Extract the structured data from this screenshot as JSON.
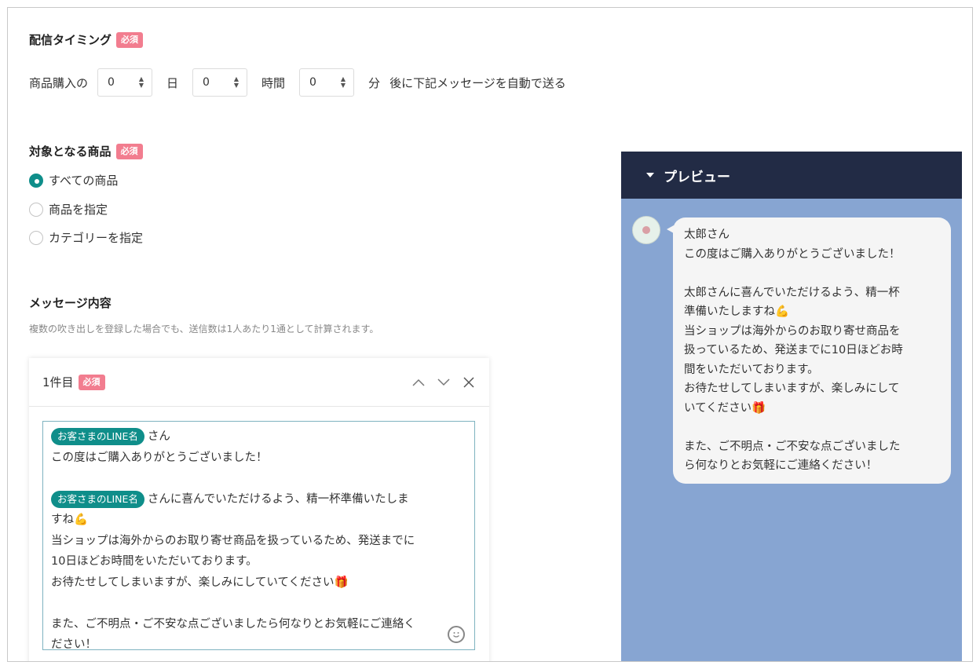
{
  "timing": {
    "title": "配信タイミング",
    "required": "必須",
    "prefix": "商品購入の",
    "days_value": "0",
    "days_unit": "日",
    "hours_value": "0",
    "hours_unit": "時間",
    "minutes_value": "0",
    "minutes_unit": "分",
    "suffix": "後に下記メッセージを自動で送る"
  },
  "target": {
    "title": "対象となる商品",
    "required": "必須",
    "options": [
      {
        "label": "すべての商品",
        "checked": true
      },
      {
        "label": "商品を指定",
        "checked": false
      },
      {
        "label": "カテゴリーを指定",
        "checked": false
      }
    ]
  },
  "message": {
    "title": "メッセージ内容",
    "note": "複数の吹き出しを登録した場合でも、送信数は1人あたり1通として計算されます。",
    "card": {
      "label": "1件目",
      "required": "必須",
      "tag_label": "お客さまのLINE名",
      "line1_text": "さん",
      "line2": "この度はご購入ありがとうございました！",
      "line4_text": "さんに喜んでいただけるよう、精一杯準備いたしま",
      "line5": "すね💪",
      "line6": "当ショップは海外からのお取り寄せ商品を扱っているため、発送までに",
      "line7": "10日ほどお時間をいただいております。",
      "line8": "お待たせしてしまいますが、楽しみにしていてください🎁",
      "line10": "また、ご不明点・ご不安な点ございましたら何なりとお気軽にご連絡く",
      "line11": "ださい！"
    }
  },
  "preview": {
    "title": "プレビュー",
    "lines": [
      "太郎さん",
      "この度はご購入ありがとうございました！",
      "",
      "太郎さんに喜んでいただけるよう、精一杯",
      "準備いたしますね💪",
      "当ショップは海外からのお取り寄せ商品を",
      "扱っているため、発送までに10日ほどお時",
      "間をいただいております。",
      "お待たせしてしまいますが、楽しみにして",
      "いてください🎁",
      "",
      "また、ご不明点・ご不安な点ございました",
      "ら何なりとお気軽にご連絡ください！"
    ]
  },
  "colors": {
    "accent": "#0f8e8a",
    "required_badge": "#f27d8f",
    "preview_header": "#222b45",
    "preview_background": "#87a5d2"
  },
  "icons": [
    "chevron-up-icon",
    "chevron-down-icon",
    "close-icon",
    "smiley-icon",
    "triangle-down-icon",
    "avatar"
  ]
}
